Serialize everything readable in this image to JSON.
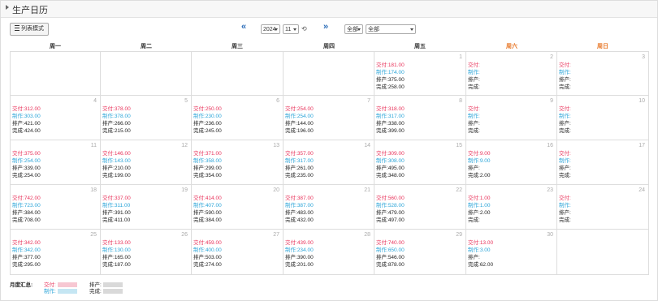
{
  "header": {
    "title": "生产日历"
  },
  "toolbar": {
    "list_mode_label": "列表模式",
    "prev_label": "«",
    "next_label": "»",
    "year": "2024",
    "month": "11",
    "refresh_label": "⟲",
    "filter1": "全部",
    "filter2": "全部"
  },
  "weekdays": [
    "周一",
    "周二",
    "周三",
    "周四",
    "周五",
    "周六",
    "周日"
  ],
  "labels": {
    "deliver": "交付:",
    "make": "制作:",
    "plan": "排产:",
    "done": "完成:"
  },
  "days": [
    {
      "d": "1",
      "deliver": "181.00",
      "make": "174.00",
      "plan": "375.00",
      "done": "258.00"
    },
    {
      "d": "2",
      "deliver": "",
      "make": "",
      "plan": "",
      "done": ""
    },
    {
      "d": "3",
      "deliver": "",
      "make": "",
      "plan": "",
      "done": ""
    },
    {
      "d": "4",
      "deliver": "312.00",
      "make": "303.00",
      "plan": "421.00",
      "done": "424.00"
    },
    {
      "d": "5",
      "deliver": "378.00",
      "make": "378.00",
      "plan": "266.00",
      "done": "215.00"
    },
    {
      "d": "6",
      "deliver": "250.00",
      "make": "230.00",
      "plan": "236.00",
      "done": "245.00"
    },
    {
      "d": "7",
      "deliver": "254.00",
      "make": "254.00",
      "plan": "144.00",
      "done": "196.00"
    },
    {
      "d": "8",
      "deliver": "318.00",
      "make": "317.00",
      "plan": "338.00",
      "done": "399.00"
    },
    {
      "d": "9",
      "deliver": "",
      "make": "",
      "plan": "",
      "done": ""
    },
    {
      "d": "10",
      "deliver": "",
      "make": "",
      "plan": "",
      "done": ""
    },
    {
      "d": "11",
      "deliver": "375.00",
      "make": "254.00",
      "plan": "339.00",
      "done": "254.00"
    },
    {
      "d": "12",
      "deliver": "146.00",
      "make": "143.00",
      "plan": "210.00",
      "done": "199.00"
    },
    {
      "d": "13",
      "deliver": "371.00",
      "make": "358.00",
      "plan": "299.00",
      "done": "354.00"
    },
    {
      "d": "14",
      "deliver": "357.00",
      "make": "317.00",
      "plan": "261.00",
      "done": "235.00"
    },
    {
      "d": "15",
      "deliver": "309.00",
      "make": "308.00",
      "plan": "495.00",
      "done": "348.00"
    },
    {
      "d": "16",
      "deliver": "9.00",
      "make": "9.00",
      "plan": "",
      "done": "2.00"
    },
    {
      "d": "17",
      "deliver": "",
      "make": "",
      "plan": "",
      "done": ""
    },
    {
      "d": "18",
      "deliver": "742.00",
      "make": "723.00",
      "plan": "384.00",
      "done": "708.00"
    },
    {
      "d": "19",
      "deliver": "337.00",
      "make": "311.00",
      "plan": "391.00",
      "done": "411.00"
    },
    {
      "d": "20",
      "deliver": "414.00",
      "make": "407.00",
      "plan": "590.00",
      "done": "384.00"
    },
    {
      "d": "21",
      "deliver": "387.00",
      "make": "387.00",
      "plan": "483.00",
      "done": "432.00"
    },
    {
      "d": "22",
      "deliver": "560.00",
      "make": "528.00",
      "plan": "479.00",
      "done": "497.00"
    },
    {
      "d": "23",
      "deliver": "1.00",
      "make": "1.00",
      "plan": "2.00",
      "done": ""
    },
    {
      "d": "24",
      "deliver": "",
      "make": "",
      "plan": "",
      "done": ""
    },
    {
      "d": "25",
      "deliver": "342.00",
      "make": "342.00",
      "plan": "377.00",
      "done": "295.00"
    },
    {
      "d": "26",
      "deliver": "133.00",
      "make": "130.00",
      "plan": "165.00",
      "done": "187.00"
    },
    {
      "d": "27",
      "deliver": "459.00",
      "make": "400.00",
      "plan": "503.00",
      "done": "274.00"
    },
    {
      "d": "28",
      "deliver": "439.00",
      "make": "234.00",
      "plan": "390.00",
      "done": "201.00"
    },
    {
      "d": "29",
      "deliver": "740.00",
      "make": "650.00",
      "plan": "546.00",
      "done": "878.00"
    },
    {
      "d": "30",
      "deliver": "13.00",
      "make": "3.00",
      "plan": "",
      "done": "62.00"
    }
  ],
  "summary": {
    "label": "月度汇总:",
    "deliver": "交付:",
    "make": "制作:",
    "plan": "排产:",
    "done": "完成:"
  },
  "colors": {
    "deliver": "#e8325a",
    "make": "#2aa4d8",
    "weekend": "#e8792b",
    "nav": "#2a6cb8"
  }
}
